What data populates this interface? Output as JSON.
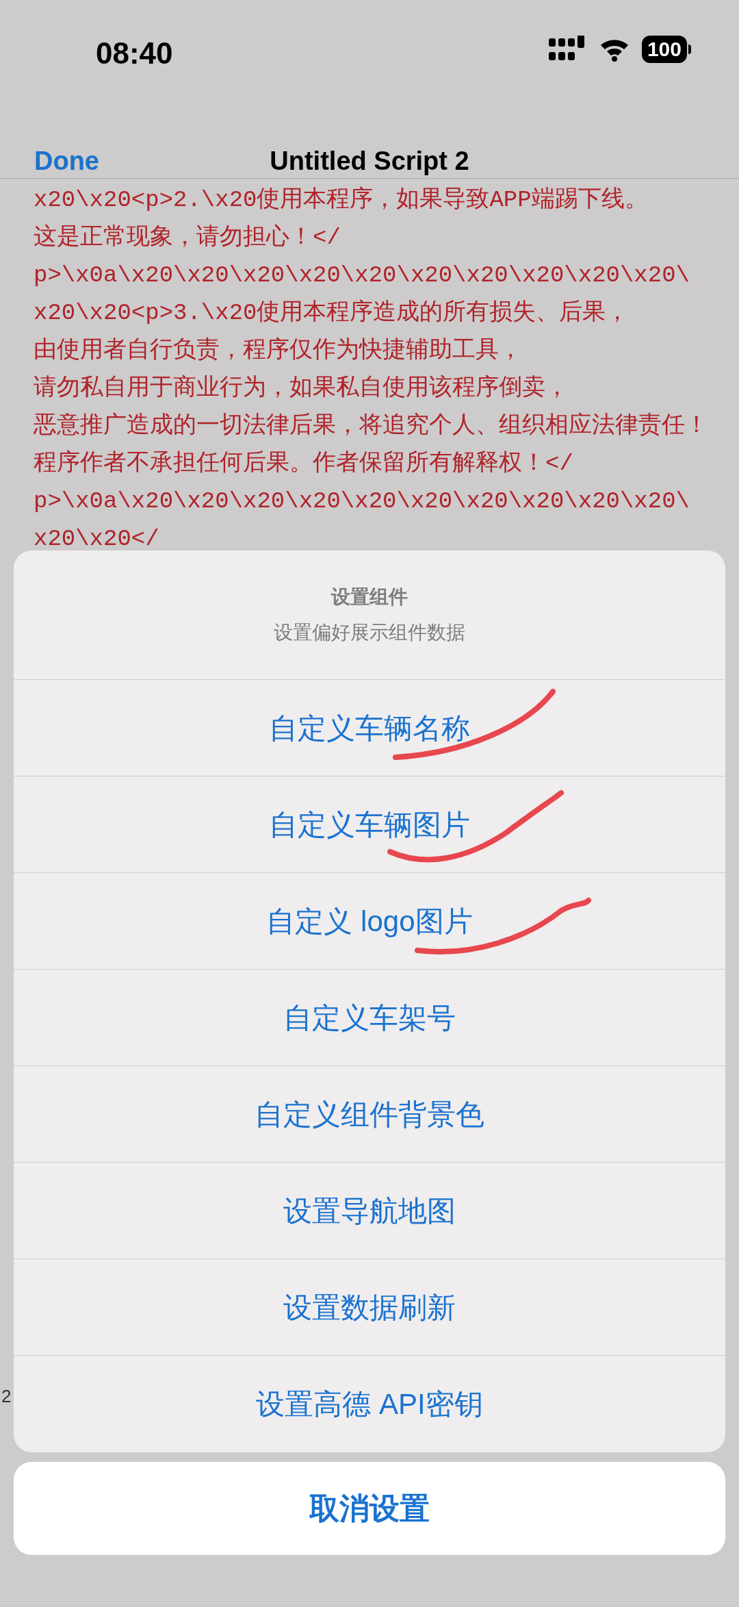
{
  "status_bar": {
    "time": "08:40",
    "battery": "100"
  },
  "nav_bar": {
    "done": "Done",
    "title": "Untitled Script 2"
  },
  "code_lines": [
    "x20\\x20<p>2.\\x20使用本程序，如果导致APP端踢下线。",
    "这是正常现象，请勿担心！</",
    "p>\\x0a\\x20\\x20\\x20\\x20\\x20\\x20\\x20\\x20\\x20\\x20\\",
    "x20\\x20<p>3.\\x20使用本程序造成的所有损失、后果，",
    "由使用者自行负责，程序仅作为快捷辅助工具，",
    "请勿私自用于商业行为，如果私自使用该程序倒卖，",
    "恶意推广造成的一切法律后果，将追究个人、组织相应法律责任！",
    "程序作者不承担任何后果。作者保留所有解释权！</",
    "p>\\x0a\\x20\\x20\\x20\\x20\\x20\\x20\\x20\\x20\\x20\\x20\\",
    "x20\\x20</"
  ],
  "background_fragment": "2",
  "action_sheet": {
    "title": "设置组件",
    "message": "设置偏好展示组件数据",
    "actions": [
      "自定义车辆名称",
      "自定义车辆图片",
      "自定义 logo图片",
      "自定义车架号",
      "自定义组件背景色",
      "设置导航地图",
      "设置数据刷新",
      "设置高德 API密钥"
    ],
    "cancel": "取消设置"
  }
}
